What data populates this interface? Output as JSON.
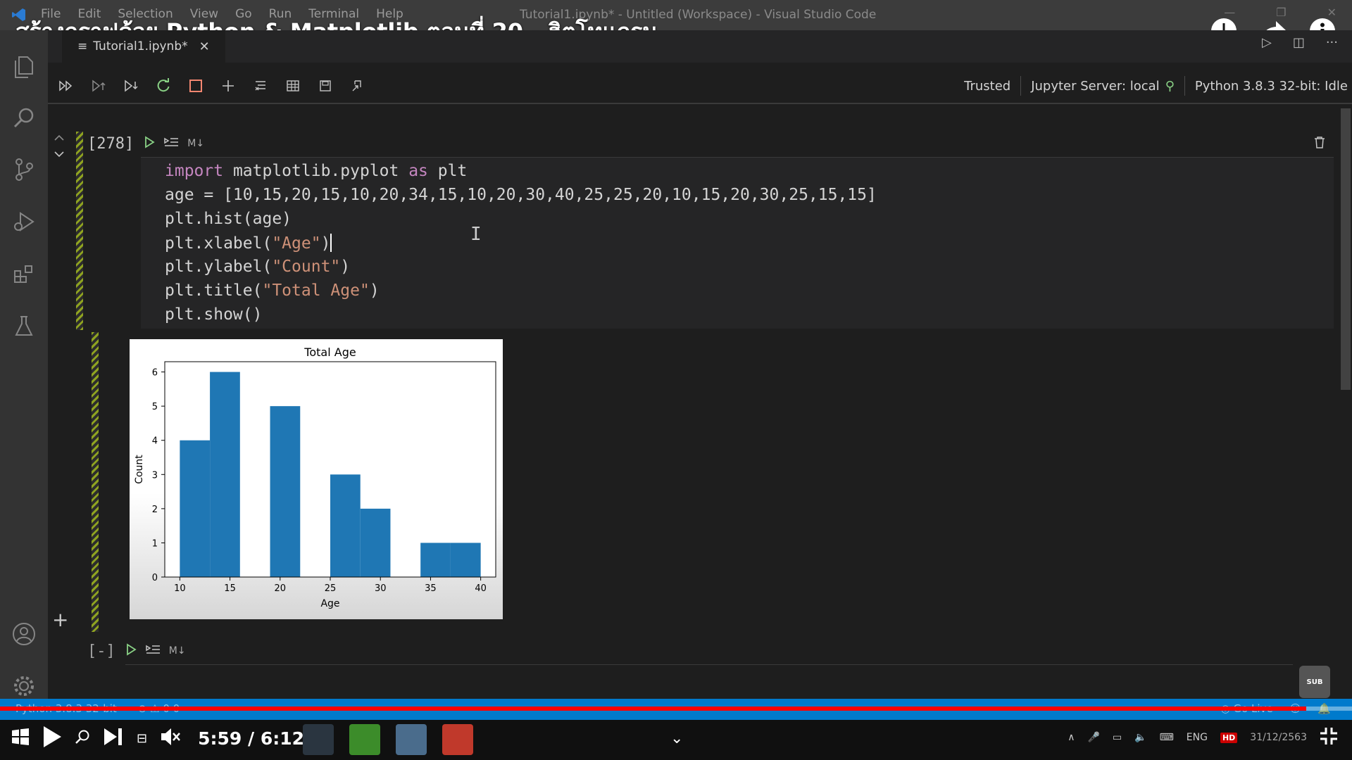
{
  "video": {
    "title": "สร้างกราฟด้วย Python & Matplotlib ตอนที่ 20 - ฮิตโทแกรม",
    "time": "5:59 / 6:12",
    "progress": 0.966
  },
  "window": {
    "title": "Tutorial1.ipynb* - Untitled (Workspace) - Visual Studio Code",
    "menu": [
      "File",
      "Edit",
      "Selection",
      "View",
      "Go",
      "Run",
      "Terminal",
      "Help"
    ]
  },
  "editor": {
    "tab_label": "Tutorial1.ipynb*"
  },
  "notebook_toolbar": {
    "trusted": "Trusted",
    "server": "Jupyter Server: local",
    "kernel": "Python 3.8.3 32-bit: Idle"
  },
  "cell1": {
    "exec_count": "[278]",
    "md_label": "M↓",
    "code": {
      "line1_kw": "import",
      "line1_a": " matplotlib.pyplot ",
      "line1_kw2": "as",
      "line1_b": " plt",
      "line2": "age = [10,15,20,15,10,20,34,15,10,20,30,40,25,25,20,10,15,20,30,25,15,15]",
      "line3": "plt.hist(age)",
      "line4_a": "plt.xlabel(",
      "line4_str": "\"Age\"",
      "line4_b": ")",
      "line5_a": "plt.ylabel(",
      "line5_str": "\"Count\"",
      "line5_b": ")",
      "line6_a": "plt.title(",
      "line6_str": "\"Total Age\"",
      "line6_b": ")",
      "line7": "plt.show()"
    }
  },
  "cell2": {
    "exec_count": "[-]",
    "md_label": "M↓"
  },
  "statusbar": {
    "python": "Python 3.8.3 32-bit",
    "problems": "0  0",
    "go_live": "Go Live"
  },
  "taskbar": {
    "date": "31/12/2563",
    "hd": "HD",
    "lang": "ENG"
  },
  "colors": {
    "bar": "#1f77b4",
    "status_blue": "#007acc",
    "progress_red": "#ff0000"
  },
  "chart_data": {
    "type": "bar",
    "title": "Total Age",
    "xlabel": "Age",
    "ylabel": "Count",
    "bins": [
      10,
      13,
      16,
      19,
      22,
      25,
      28,
      31,
      34,
      37,
      40
    ],
    "values": [
      4,
      6,
      0,
      5,
      0,
      3,
      2,
      0,
      1,
      1
    ],
    "xticks": [
      10,
      15,
      20,
      25,
      30,
      35,
      40
    ],
    "yticks": [
      0,
      1,
      2,
      3,
      4,
      5,
      6
    ],
    "xlim": [
      8.5,
      41.5
    ],
    "ylim": [
      0,
      6.3
    ],
    "grid": false
  }
}
